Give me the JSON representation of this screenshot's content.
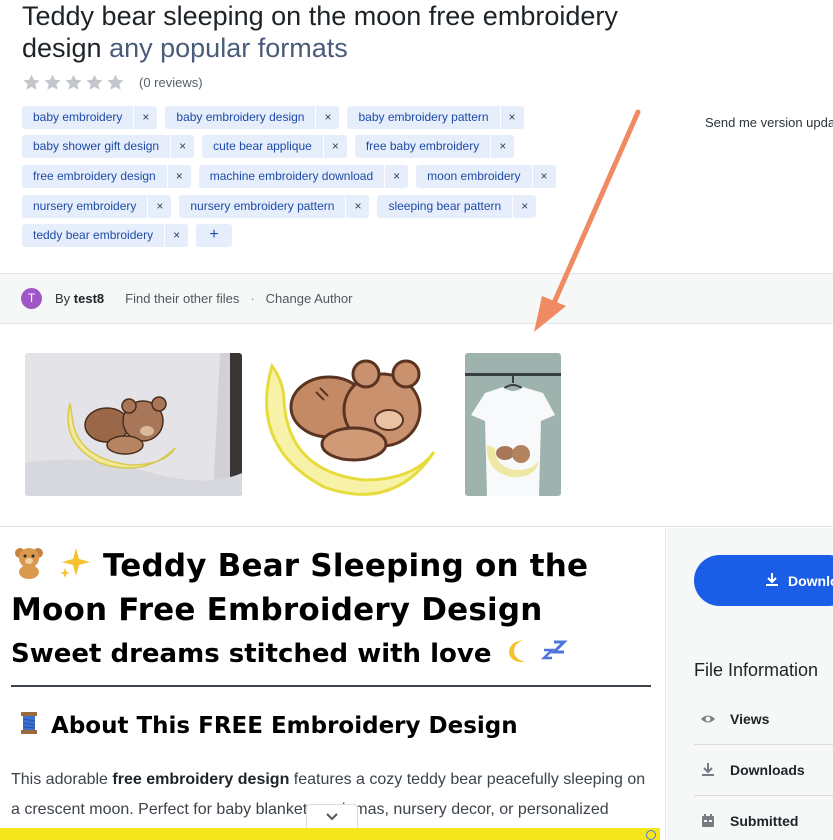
{
  "design": {
    "title_main": "Teddy bear sleeping on the moon free embroidery design",
    "title_accent": "any popular formats",
    "reviews": "(0 reviews)",
    "send_me_text": "Send me version upda"
  },
  "tags": [
    [
      "baby embroidery",
      "baby embroidery design",
      "baby embroidery pattern"
    ],
    [
      "baby shower gift design",
      "cute bear applique",
      "free baby embroidery"
    ],
    [
      "free embroidery design",
      "machine embroidery download",
      "moon embroidery"
    ],
    [
      "nursery embroidery",
      "nursery embroidery pattern",
      "sleeping bear pattern"
    ],
    [
      "teddy bear embroidery"
    ]
  ],
  "tag_remove_symbol": "×",
  "tag_add_symbol": "+",
  "author": {
    "avatar_letter": "T",
    "by_label": "By",
    "name": "test8",
    "find_files": "Find their other files",
    "separator": "·",
    "change_author": "Change Author"
  },
  "article": {
    "heading": "Teddy Bear Sleeping on the Moon Free Embroidery Design",
    "heading_emojis": [
      "teddy-bear-emoji",
      "sparkles-emoji"
    ],
    "subheading": "Sweet dreams stitched with love",
    "subheading_emojis": [
      "crescent-moon-emoji",
      "zzz-emoji"
    ],
    "section_heading": "About This FREE Embroidery Design",
    "section_emoji": "thread-spool-emoji",
    "para_lead": "This adorable ",
    "para_bold": "free embroidery design",
    "para_rest": " features a cozy teddy bear peacefully sleeping on a crescent moon. Perfect for baby blankets, pajamas, nursery decor, or personalized"
  },
  "sidebar": {
    "download_label": "Downlo",
    "file_info_title": "File Information",
    "rows": [
      "Views",
      "Downloads",
      "Submitted"
    ]
  },
  "colors": {
    "accent_title": "#4a5c7a",
    "tag_bg": "#e6eefc",
    "tag_text": "#1e4aa6",
    "download_button": "#1a5ee8",
    "annotation_arrow": "#f08a63",
    "avatar": "#a156c7",
    "ad_strip": "#f5e51c"
  },
  "rating": {
    "stars": 0,
    "max": 5
  }
}
